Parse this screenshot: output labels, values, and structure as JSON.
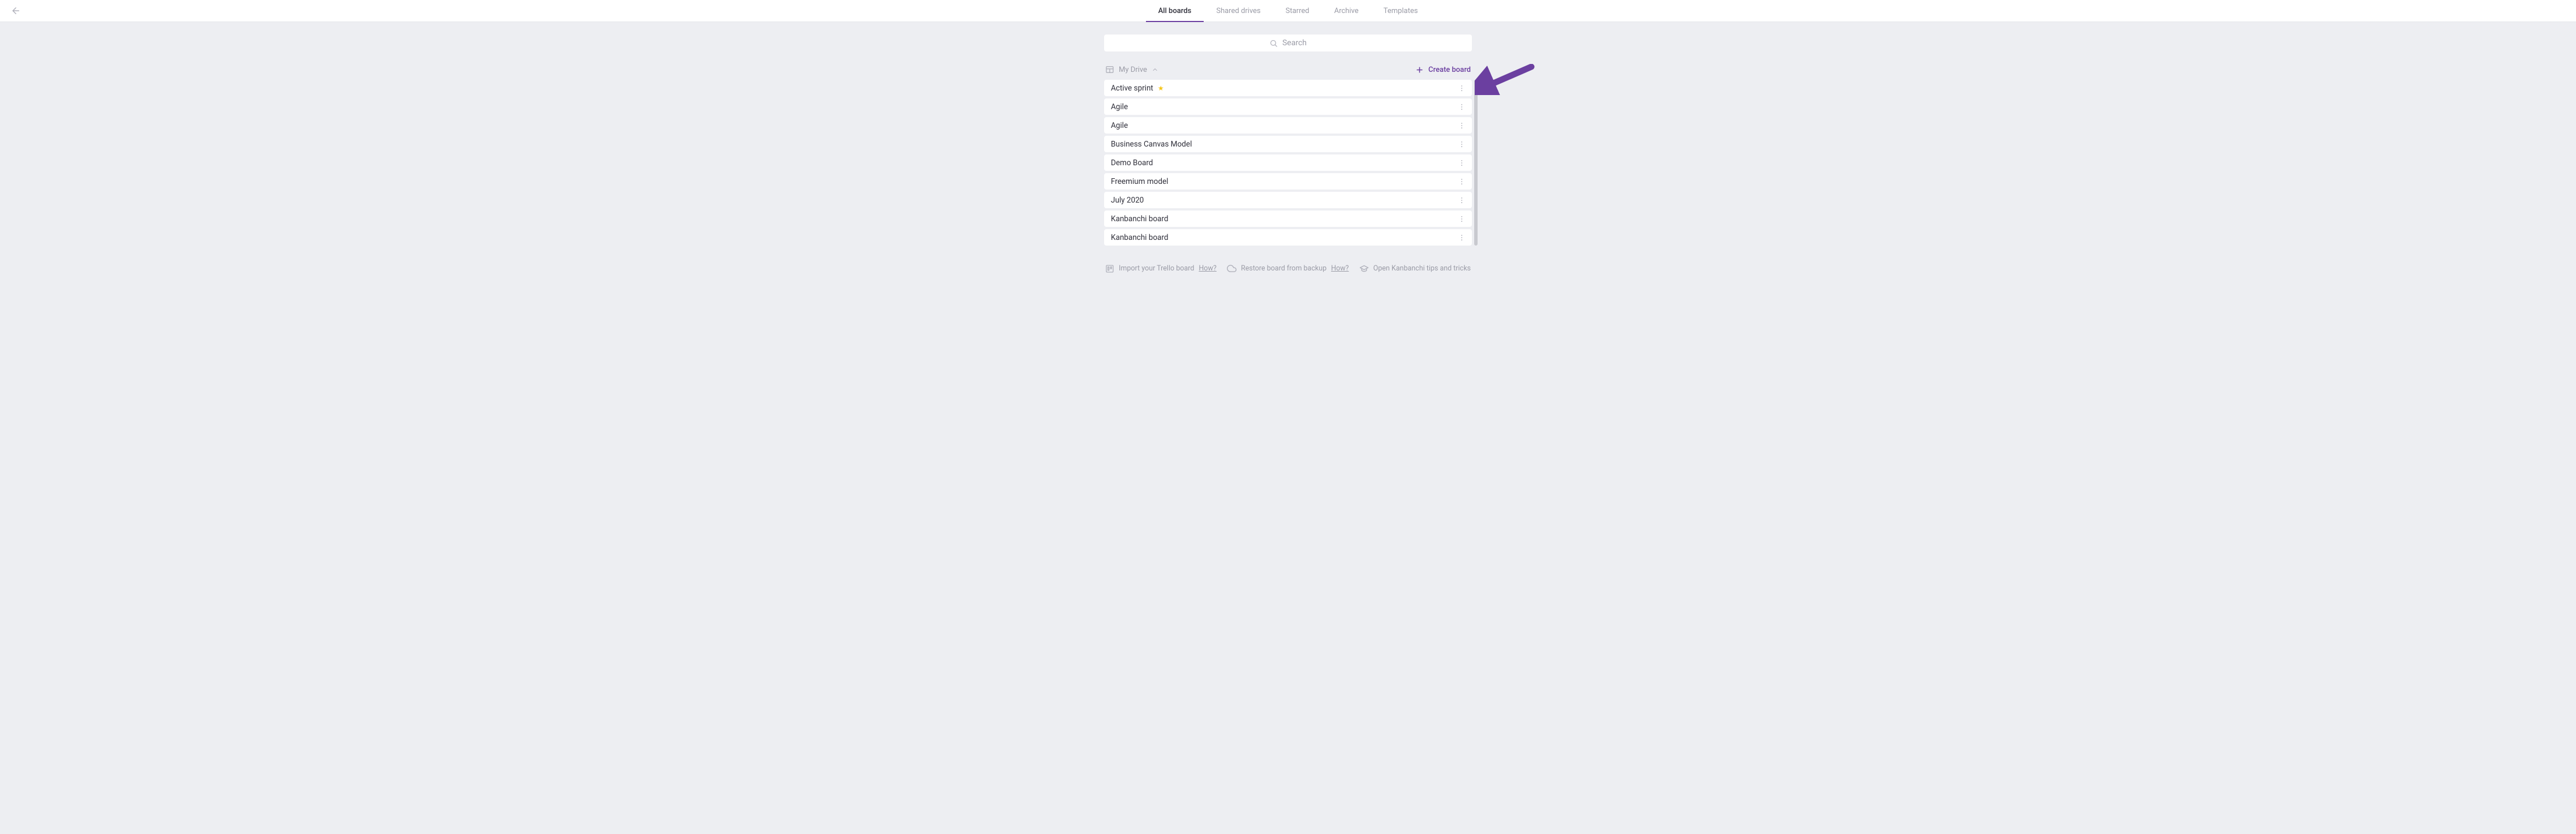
{
  "tabs": [
    "All boards",
    "Shared drives",
    "Starred",
    "Archive",
    "Templates"
  ],
  "active_tab_index": 0,
  "search": {
    "placeholder": "Search"
  },
  "drive": {
    "label": "My Drive"
  },
  "create_board_label": "Create board",
  "boards": [
    {
      "name": "Active sprint",
      "starred": true
    },
    {
      "name": "Agile",
      "starred": false
    },
    {
      "name": "Agile",
      "starred": false
    },
    {
      "name": "Business Canvas Model",
      "starred": false
    },
    {
      "name": "Demo Board",
      "starred": false
    },
    {
      "name": "Freemium model",
      "starred": false
    },
    {
      "name": "July 2020",
      "starred": false
    },
    {
      "name": "Kanbanchi board",
      "starred": false
    },
    {
      "name": "Kanbanchi board",
      "starred": false
    }
  ],
  "footer": {
    "import_trello": "Import your Trello board",
    "restore_backup": "Restore board from backup",
    "how": "How?",
    "tips": "Open Kanbanchi tips and tricks"
  },
  "colors": {
    "accent": "#6b3fa0",
    "star": "#f5c518",
    "bg": "#edeef2"
  }
}
